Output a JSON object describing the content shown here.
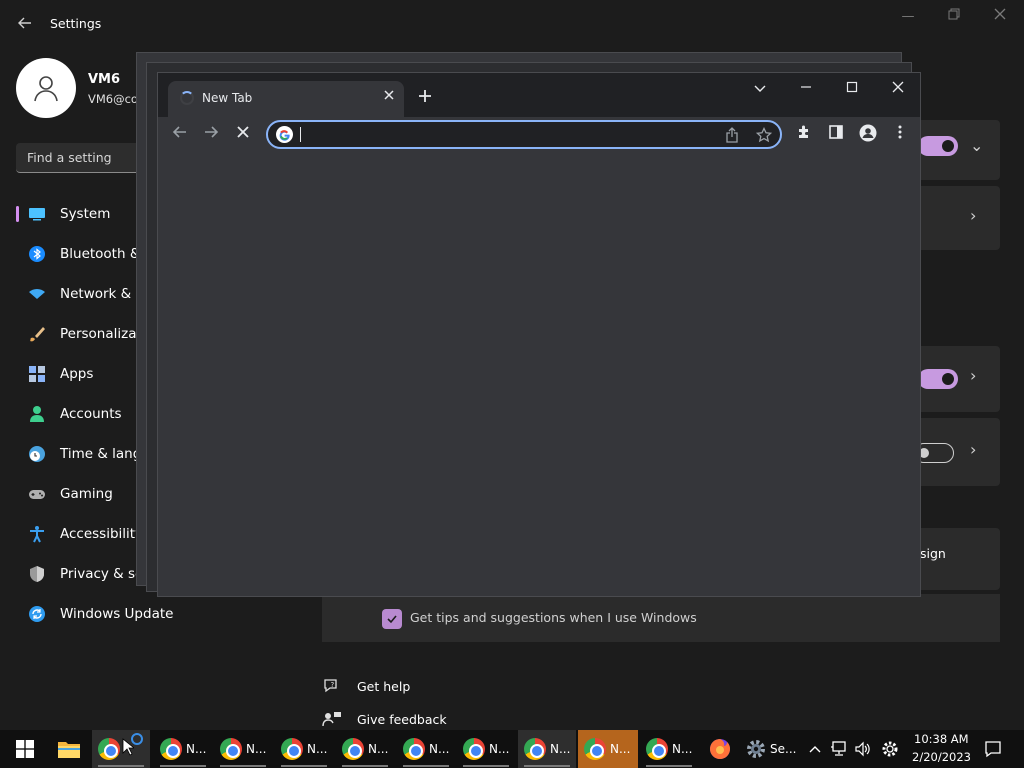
{
  "settings": {
    "title": "Settings",
    "user": {
      "name": "VM6",
      "email": "VM6@co"
    },
    "search_placeholder": "Find a setting",
    "nav": [
      {
        "label": "System",
        "icon": "monitor-icon",
        "color": "#4cc2ff"
      },
      {
        "label": "Bluetooth &",
        "icon": "bluetooth-icon",
        "color": "#1a8cff"
      },
      {
        "label": "Network & i",
        "icon": "wifi-icon",
        "color": "#3fa9f5"
      },
      {
        "label": "Personalizati",
        "icon": "brush-icon",
        "color": "#e8a95a"
      },
      {
        "label": "Apps",
        "icon": "apps-icon",
        "color": "#8ab4f8"
      },
      {
        "label": "Accounts",
        "icon": "person-icon",
        "color": "#3ecf8e"
      },
      {
        "label": "Time & lang",
        "icon": "clock-globe-icon",
        "color": "#4aa3df"
      },
      {
        "label": "Gaming",
        "icon": "gamepad-icon",
        "color": "#b0b0b0"
      },
      {
        "label": "Accessibility",
        "icon": "accessibility-icon",
        "color": "#3a9ff0"
      },
      {
        "label": "Privacy & se",
        "icon": "shield-icon",
        "color": "#9a9a9a"
      },
      {
        "label": "Windows Update",
        "icon": "update-icon",
        "color": "#2f9cf0"
      }
    ],
    "content": {
      "partial_row_text": "sign",
      "tips_label": "Get tips and suggestions when I use Windows"
    },
    "help": {
      "get_help": "Get help",
      "give_feedback": "Give feedback"
    },
    "accent": "#c79ae0"
  },
  "chrome": {
    "tab_title": "New Tab",
    "omnibox_value": ""
  },
  "taskbar": {
    "items": [
      {
        "label": ""
      },
      {
        "label": "N..."
      },
      {
        "label": "N..."
      },
      {
        "label": "N..."
      },
      {
        "label": "N..."
      },
      {
        "label": "N..."
      },
      {
        "label": "N..."
      },
      {
        "label": "N..."
      },
      {
        "label": "N..."
      },
      {
        "label": "N..."
      }
    ],
    "settings_label": "Se...",
    "time": "10:38 AM",
    "date": "2/20/2023"
  }
}
